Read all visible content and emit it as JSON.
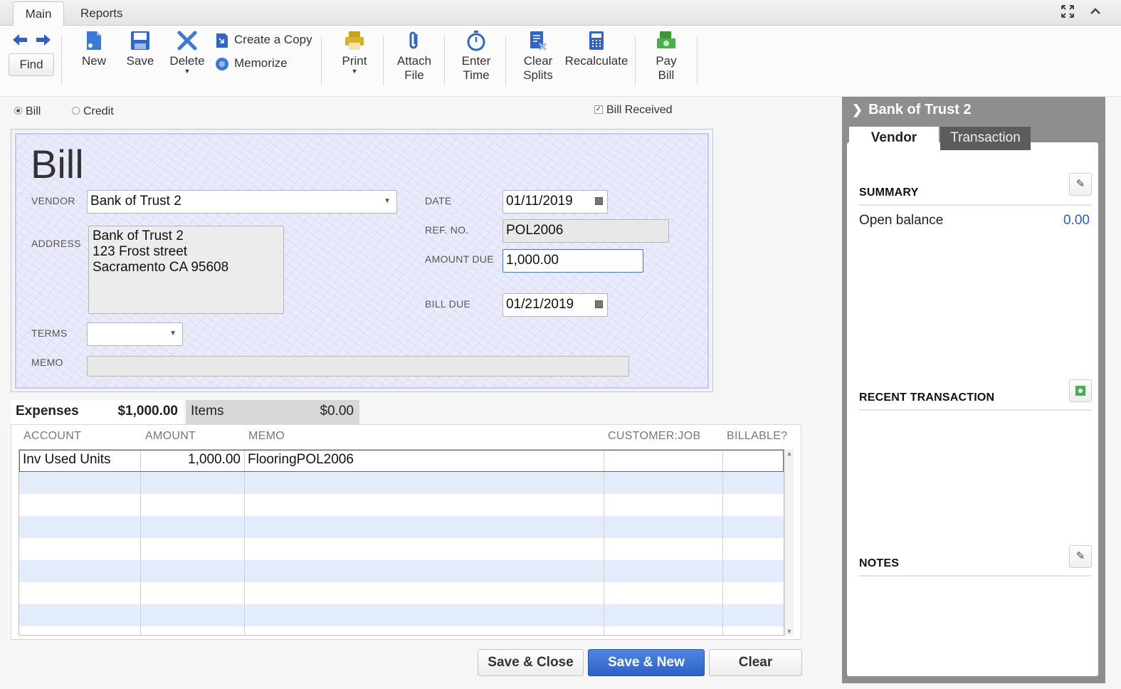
{
  "tabs": {
    "main": "Main",
    "reports": "Reports"
  },
  "toolbar": {
    "find": "Find",
    "new": "New",
    "save": "Save",
    "delete": "Delete",
    "create_copy": "Create a Copy",
    "memorize": "Memorize",
    "print": "Print",
    "attach_file": "Attach\nFile",
    "enter_time": "Enter\nTime",
    "clear_splits": "Clear\nSplits",
    "recalculate": "Recalculate",
    "pay_bill": "Pay\nBill"
  },
  "mode": {
    "bill": "Bill",
    "credit": "Credit",
    "selected": "Bill",
    "bill_received_label": "Bill Received",
    "bill_received": true
  },
  "form": {
    "title": "Bill",
    "vendor_label": "VENDOR",
    "vendor": "Bank of Trust 2",
    "address_label": "ADDRESS",
    "address_lines": [
      "Bank of Trust 2",
      "123 Frost street",
      "Sacramento CA  95608"
    ],
    "terms_label": "TERMS",
    "terms": "",
    "memo_label": "MEMO",
    "memo": "",
    "date_label": "DATE",
    "date": "01/11/2019",
    "ref_label": "REF. NO.",
    "ref": "POL2006",
    "amount_label": "AMOUNT DUE",
    "amount": "1,000.00",
    "due_label": "BILL DUE",
    "due": "01/21/2019"
  },
  "detail_tabs": {
    "expenses_label": "Expenses",
    "expenses_total": "$1,000.00",
    "items_label": "Items",
    "items_total": "$0.00"
  },
  "grid": {
    "columns": [
      "ACCOUNT",
      "AMOUNT",
      "MEMO",
      "CUSTOMER:JOB",
      "BILLABLE?"
    ],
    "rows": [
      {
        "account": "Inv Used Units",
        "amount": "1,000.00",
        "memo": "FlooringPOL2006",
        "customer_job": "",
        "billable": ""
      }
    ]
  },
  "buttons": {
    "save_close": "Save & Close",
    "save_new": "Save & New",
    "clear": "Clear"
  },
  "panel": {
    "title": "Bank of Trust 2",
    "tab_vendor": "Vendor",
    "tab_transaction": "Transaction",
    "summary": "SUMMARY",
    "open_balance_label": "Open balance",
    "open_balance": "0.00",
    "recent": "RECENT TRANSACTION",
    "notes": "NOTES"
  },
  "colors": {
    "primary_button": "#2d62c4",
    "link_value": "#2a5dbf",
    "paper": "#e9ebfa",
    "row_alt": "#e2ecfa"
  }
}
